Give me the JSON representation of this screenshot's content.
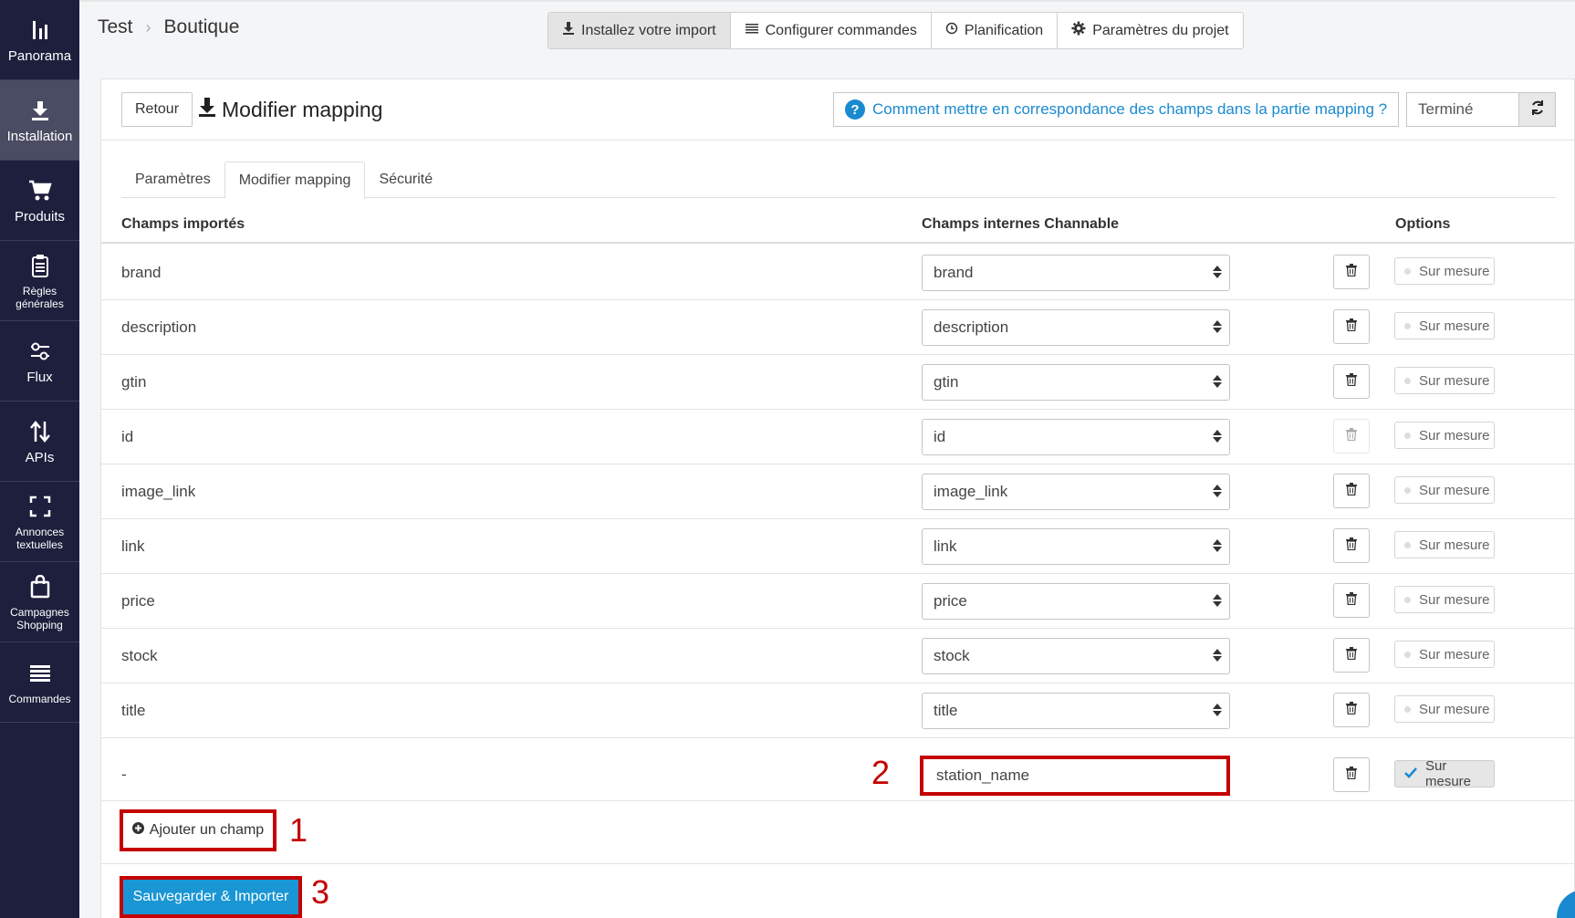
{
  "sidebar": {
    "items": [
      {
        "label": "Panorama",
        "icon": "bar-chart-icon"
      },
      {
        "label": "Installation",
        "icon": "download-icon"
      },
      {
        "label": "Produits",
        "icon": "cart-icon"
      },
      {
        "label": "Règles générales",
        "icon": "clipboard-icon"
      },
      {
        "label": "Flux",
        "icon": "sliders-icon"
      },
      {
        "label": "APIs",
        "icon": "arrows-updown-icon"
      },
      {
        "label": "Annonces textuelles",
        "icon": "expand-icon"
      },
      {
        "label": "Campagnes Shopping",
        "icon": "bag-icon"
      },
      {
        "label": "Commandes",
        "icon": "list-icon"
      }
    ],
    "active_index": 1
  },
  "breadcrumb": {
    "project": "Test",
    "page": "Boutique"
  },
  "top_tabs": [
    {
      "label": "Installez votre import",
      "icon": "download-icon"
    },
    {
      "label": "Configurer commandes",
      "icon": "list-icon"
    },
    {
      "label": "Planification",
      "icon": "clock-icon"
    },
    {
      "label": "Paramètres du projet",
      "icon": "gear-icon"
    }
  ],
  "header": {
    "back_label": "Retour",
    "title": "Modifier mapping",
    "help_text": "Comment mettre en correspondance des champs dans la partie mapping ?",
    "status": "Terminé"
  },
  "tabs": [
    {
      "label": "Paramètres"
    },
    {
      "label": "Modifier mapping"
    },
    {
      "label": "Sécurité"
    }
  ],
  "table": {
    "headers": {
      "imported": "Champs importés",
      "internal": "Champs internes Channable",
      "options": "Options"
    },
    "rows": [
      {
        "field": "brand",
        "mapped": "brand",
        "option": "Sur mesure"
      },
      {
        "field": "description",
        "mapped": "description",
        "option": "Sur mesure"
      },
      {
        "field": "gtin",
        "mapped": "gtin",
        "option": "Sur mesure"
      },
      {
        "field": "id",
        "mapped": "id",
        "option": "Sur mesure"
      },
      {
        "field": "image_link",
        "mapped": "image_link",
        "option": "Sur mesure"
      },
      {
        "field": "link",
        "mapped": "link",
        "option": "Sur mesure"
      },
      {
        "field": "price",
        "mapped": "price",
        "option": "Sur mesure"
      },
      {
        "field": "stock",
        "mapped": "stock",
        "option": "Sur mesure"
      },
      {
        "field": "title",
        "mapped": "title",
        "option": "Sur mesure"
      }
    ],
    "custom_row": {
      "field": "-",
      "value": "station_name",
      "option": "Sur mesure"
    }
  },
  "annotations": {
    "one": "1",
    "two": "2",
    "three": "3"
  },
  "actions": {
    "add_label": "Ajouter un champ",
    "save_label": "Sauvegarder & Importer"
  },
  "colors": {
    "sidebar": "#1d1f3d",
    "accent": "#1a8ad0",
    "highlight": "#c40000",
    "save_button": "#1a96d4"
  }
}
